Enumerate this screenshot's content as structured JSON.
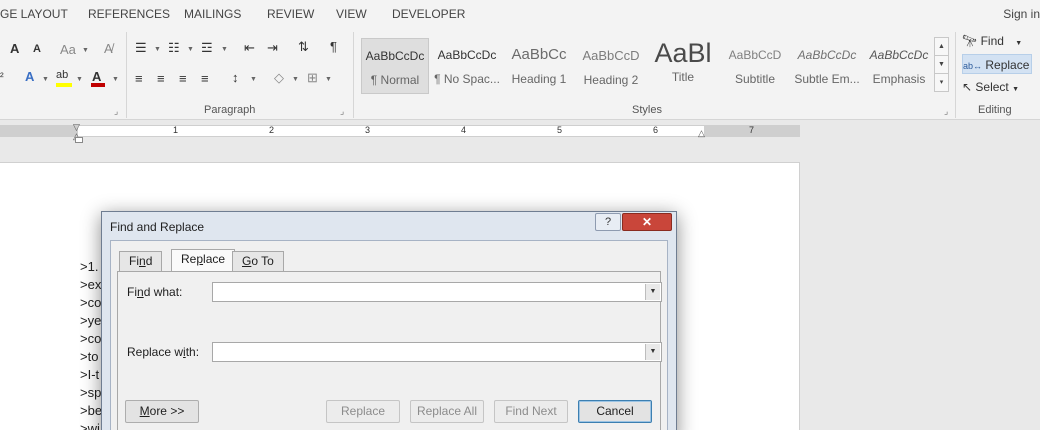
{
  "ribbon_tabs": [
    "GE LAYOUT",
    "REFERENCES",
    "MAILINGS",
    "REVIEW",
    "VIEW",
    "DEVELOPER"
  ],
  "sign_in": "Sign in",
  "groups": {
    "paragraph": "Paragraph",
    "styles": "Styles",
    "editing": "Editing"
  },
  "styles": [
    {
      "sample": "AaBbCcDc",
      "name": "¶ Normal"
    },
    {
      "sample": "AaBbCcDc",
      "name": "¶ No Spac..."
    },
    {
      "sample": "AaBbCc",
      "name": "Heading 1"
    },
    {
      "sample": "AaBbCcD",
      "name": "Heading 2"
    },
    {
      "sample": "AaBl",
      "name": "Title"
    },
    {
      "sample": "AaBbCcD",
      "name": "Subtitle"
    },
    {
      "sample": "AaBbCcDc",
      "name": "Subtle Em..."
    },
    {
      "sample": "AaBbCcDc",
      "name": "Emphasis"
    }
  ],
  "editing": {
    "find": "Find",
    "replace": "Replace",
    "select": "Select"
  },
  "ruler_numbers": [
    "1",
    "2",
    "3",
    "4",
    "5",
    "6",
    "7"
  ],
  "doc_lines": [
    ">1.",
    ">ex",
    ">co",
    ">ye",
    ">co",
    ">to",
    ">I-t",
    ">sp",
    ">be",
    ">wi"
  ],
  "dialog": {
    "title": "Find and Replace",
    "help": "?",
    "close": "✕",
    "tabs": [
      {
        "prefix": "Fi",
        "mnemonic": "n",
        "suffix": "d"
      },
      {
        "prefix": "Re",
        "mnemonic": "p",
        "suffix": "lace"
      },
      {
        "prefix": "",
        "mnemonic": "G",
        "suffix": "o To"
      }
    ],
    "find_label": {
      "prefix": "Fi",
      "mnemonic": "n",
      "suffix": "d what:"
    },
    "replace_label": {
      "prefix": "Replace w",
      "mnemonic": "i",
      "suffix": "th:"
    },
    "find_value": "",
    "replace_value": "",
    "more": {
      "prefix": "",
      "mnemonic": "M",
      "suffix": "ore >>"
    },
    "buttons": {
      "replace": "Replace",
      "replace_all": "Replace All",
      "find_next": "Find Next",
      "cancel": "Cancel"
    }
  },
  "colors": {
    "highlight": "#ffff00",
    "font_color": "#c00000",
    "close_red": "#c9463a"
  }
}
